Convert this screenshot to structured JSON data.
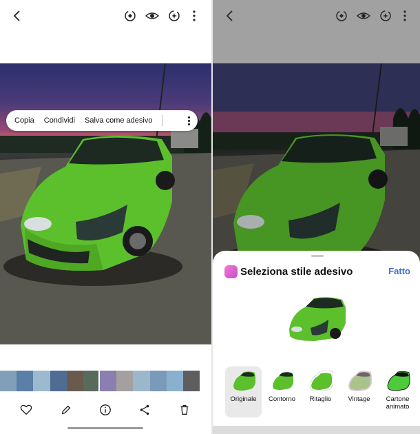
{
  "left_panel": {
    "context_menu": {
      "items": [
        "Copia",
        "Condividi",
        "Salva come adesivo"
      ],
      "more_icon": "more-vertical-icon"
    },
    "topbar_icons": [
      "back-arrow-icon",
      "remaster-icon",
      "eye-icon",
      "auto-enhance-icon",
      "more-vertical-icon"
    ],
    "bottombar_icons": [
      "heart-icon",
      "pencil-icon",
      "info-icon",
      "share-icon",
      "trash-icon"
    ]
  },
  "right_panel": {
    "sheet": {
      "title": "Seleziona stile adesivo",
      "done_label": "Fatto",
      "styles": [
        {
          "label": "Originale",
          "selected": true
        },
        {
          "label": "Contorno",
          "selected": false
        },
        {
          "label": "Ritaglio",
          "selected": false
        },
        {
          "label": "Vintage",
          "selected": false
        },
        {
          "label": "Cartone animato",
          "selected": false
        }
      ]
    }
  },
  "colors": {
    "car_green": "#5cbf2c",
    "done_blue": "#3a6cd9",
    "sheet_icon_pink": "#e066cf"
  }
}
